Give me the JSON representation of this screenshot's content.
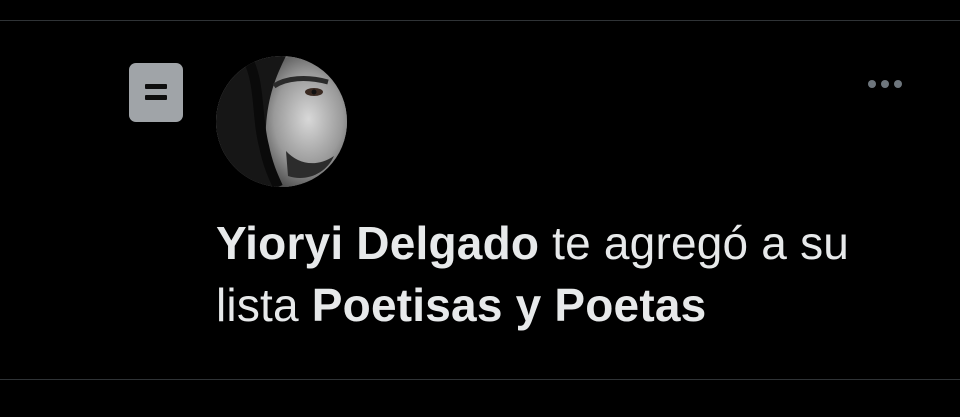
{
  "notification": {
    "icon": "list-icon",
    "avatar": "user-avatar",
    "more_icon": "more-options-icon",
    "user_name": "Yioryi Delgado",
    "action_text": " te agregó a su lista ",
    "list_name": "Poetisas y Poetas"
  },
  "colors": {
    "background": "#000000",
    "text": "#e7e9ea",
    "icon_badge": "#a0a4a8",
    "muted": "#6e767d",
    "divider": "#2f3336"
  }
}
